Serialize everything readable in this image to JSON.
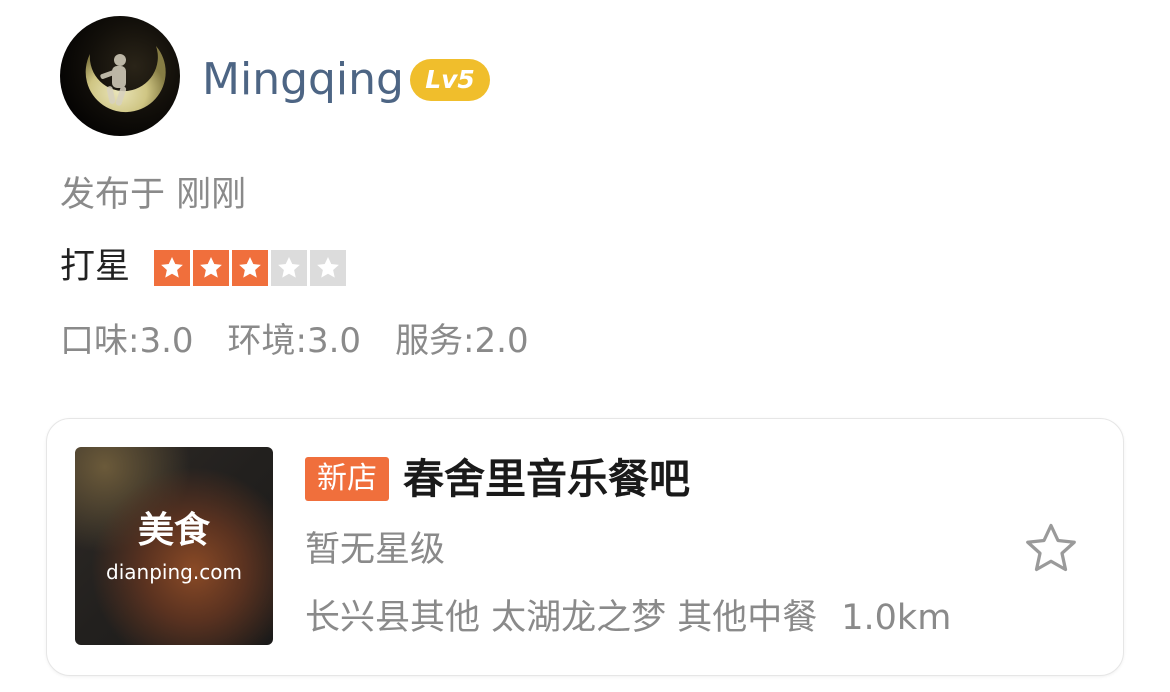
{
  "user": {
    "name": "Mingqing",
    "level": "Lv5"
  },
  "post": {
    "published_prefix": "发布于",
    "published_time": "刚刚",
    "rating_label": "打星",
    "rating_stars": 3,
    "rating_max": 5,
    "scores": [
      {
        "text": "口味:3.0"
      },
      {
        "text": "环境:3.0"
      },
      {
        "text": "服务:2.0"
      }
    ]
  },
  "shop": {
    "thumb_title": "美食",
    "thumb_site": "dianping.com",
    "badge": "新店",
    "name": "春舍里音乐餐吧",
    "star_level": "暂无星级",
    "region": "长兴县其他 太湖龙之梦 其他中餐",
    "distance": "1.0km"
  },
  "colors": {
    "accent": "#f06f3c",
    "level_badge": "#f0be2c",
    "username": "#4d6584",
    "secondary_text": "#8a8a8a"
  },
  "icons": {
    "favorite": "star-outline-icon",
    "rating": "star-icon"
  }
}
